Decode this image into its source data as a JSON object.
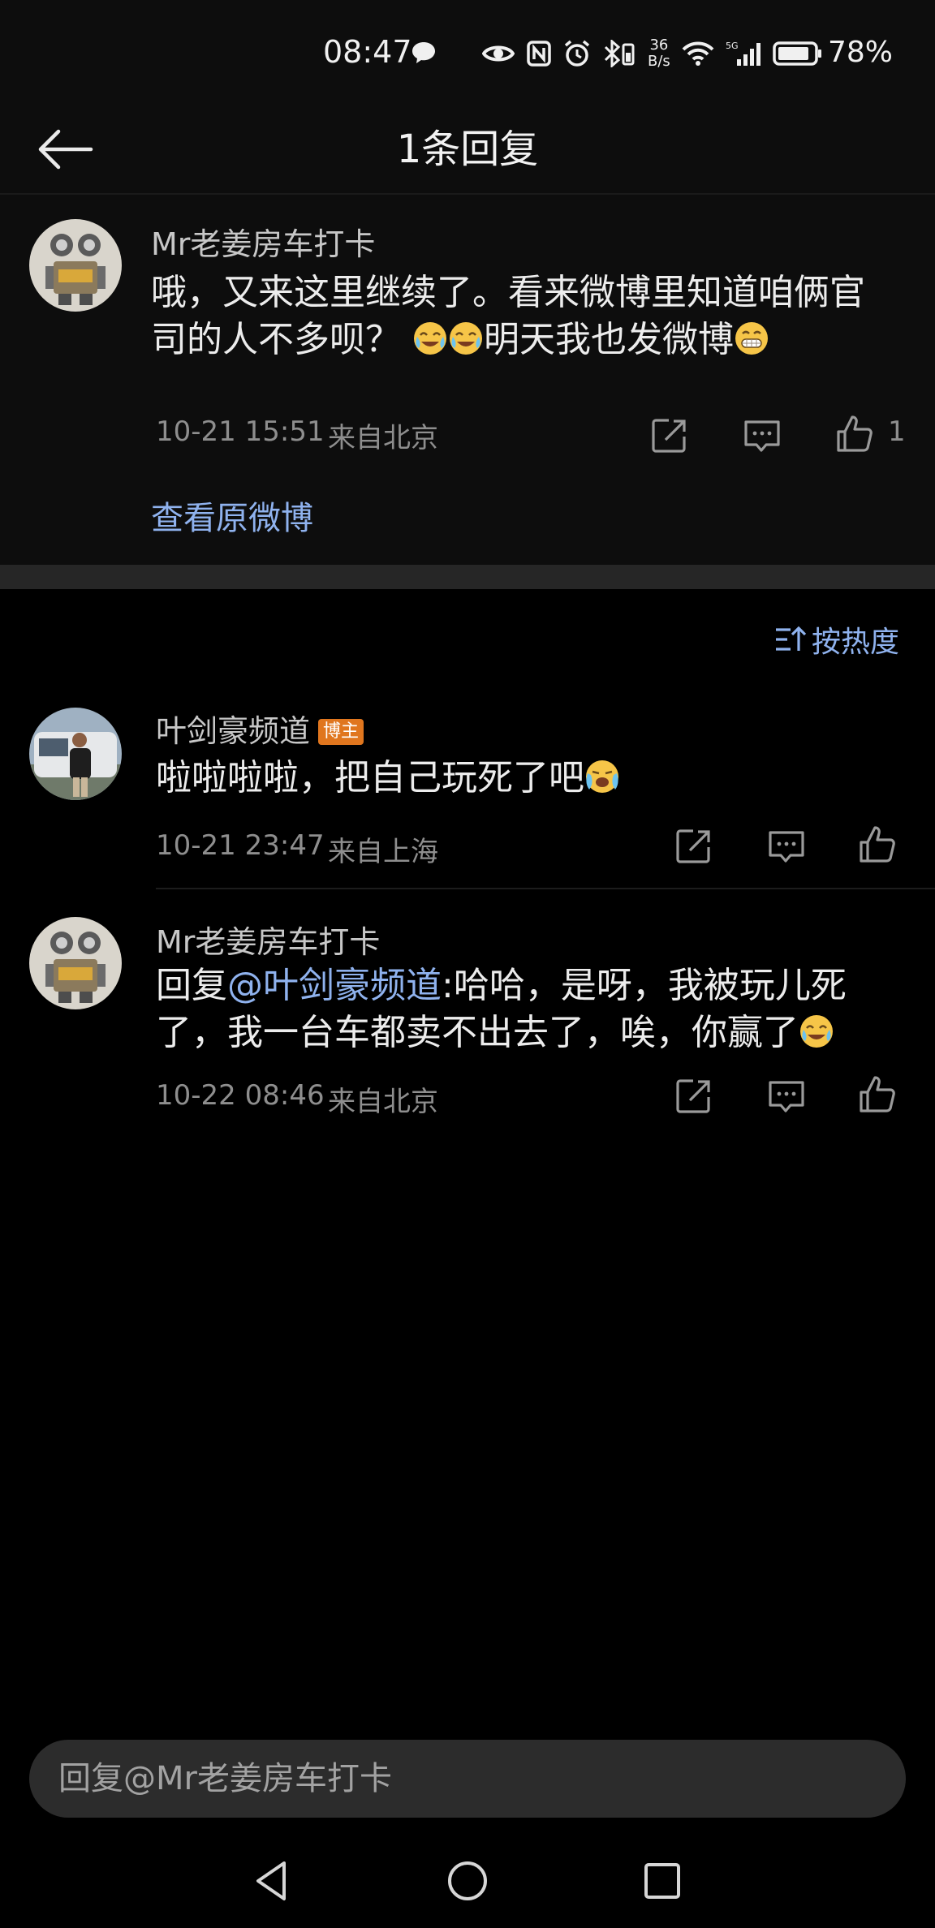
{
  "status": {
    "time": "08:47",
    "net_speed_value": "36",
    "net_speed_unit": "B/s",
    "battery": "78%"
  },
  "header": {
    "title": "1条回复"
  },
  "original_comment": {
    "user": "Mr老姜房车打卡",
    "text": "哦，又来这里继续了。看来微博里知道咱俩官司的人不多呗？",
    "text_tail": "明天我也发微博",
    "timestamp": "10-21 15:51",
    "location": "来自北京",
    "likes": "1",
    "view_original": "查看原微博"
  },
  "sort": {
    "label": "按热度"
  },
  "replies": [
    {
      "user": "叶剑豪频道",
      "badge": "博主",
      "text": "啦啦啦啦，把自己玩死了吧",
      "timestamp": "10-21 23:47",
      "location": "来自上海"
    },
    {
      "user": "Mr老姜房车打卡",
      "prefix": "回复",
      "mention": "@叶剑豪频道",
      "text": ":哈哈，是呀，我被玩儿死了，我一台车都卖不出去了，唉，你赢了",
      "timestamp": "10-22 08:46",
      "location": "来自北京"
    }
  ],
  "reply_input": {
    "placeholder": "回复@Mr老姜房车打卡"
  }
}
